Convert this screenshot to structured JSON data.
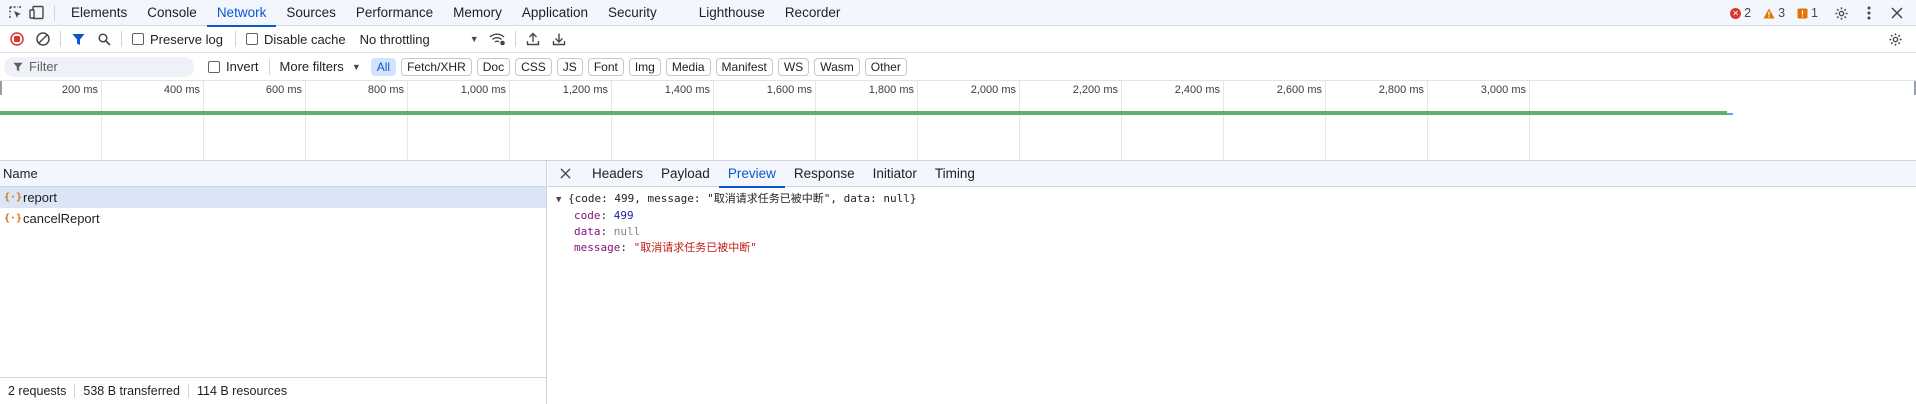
{
  "tabs": [
    "Elements",
    "Console",
    "Network",
    "Sources",
    "Performance",
    "Memory",
    "Application",
    "Security",
    "Lighthouse",
    "Recorder"
  ],
  "active_tab": "Network",
  "issues": {
    "errors": "2",
    "warnings": "3",
    "info": "1"
  },
  "toolbar": {
    "preserve_log": "Preserve log",
    "disable_cache": "Disable cache",
    "throttling": "No throttling"
  },
  "filterbar": {
    "placeholder": "Filter",
    "invert": "Invert",
    "more_filters": "More filters",
    "chips": [
      "All",
      "Fetch/XHR",
      "Doc",
      "CSS",
      "JS",
      "Font",
      "Img",
      "Media",
      "Manifest",
      "WS",
      "Wasm",
      "Other"
    ],
    "active_chip": "All"
  },
  "timeline": {
    "ticks": [
      "200 ms",
      "400 ms",
      "600 ms",
      "800 ms",
      "1,000 ms",
      "1,200 ms",
      "1,400 ms",
      "1,600 ms",
      "1,800 ms",
      "2,000 ms",
      "2,200 ms",
      "2,400 ms",
      "2,600 ms",
      "2,800 ms",
      "3,000 ms"
    ]
  },
  "requests": {
    "header": "Name",
    "items": [
      {
        "name": "report",
        "selected": true
      },
      {
        "name": "cancelReport",
        "selected": false
      }
    ]
  },
  "status": {
    "requests": "2 requests",
    "transferred": "538 B transferred",
    "resources": "114 B resources"
  },
  "detail": {
    "tabs": [
      "Headers",
      "Payload",
      "Preview",
      "Response",
      "Initiator",
      "Timing"
    ],
    "active": "Preview",
    "summary": "{code: 499, message: \"取消请求任务已被中断\", data: null}",
    "code_key": "code",
    "code_val": "499",
    "data_key": "data",
    "data_val": "null",
    "message_key": "message",
    "message_val": "\"取消请求任务已被中断\""
  },
  "colors": {
    "accent": "#0b57d0",
    "error": "#dc362e",
    "warning": "#e37400",
    "info": "#e37400"
  }
}
